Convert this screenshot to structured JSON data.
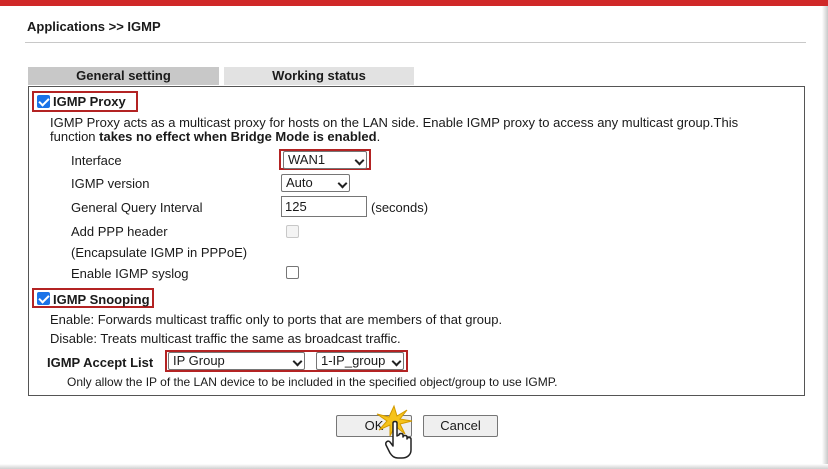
{
  "header": {
    "title": "Applications >> IGMP"
  },
  "tabs": [
    {
      "label": "General setting"
    },
    {
      "label": "Working status"
    }
  ],
  "proxy": {
    "label": "IGMP Proxy",
    "checked": true,
    "desc_line1": "IGMP Proxy acts as a multicast proxy for hosts on the LAN side. Enable IGMP proxy to access any multicast group.This",
    "desc_line2_prefix": "function ",
    "desc_line2_bold": "takes no effect when Bridge Mode is enabled",
    "desc_line2_suffix": ".",
    "interface_label": "Interface",
    "interface_value": "WAN1",
    "version_label": "IGMP version",
    "version_value": "Auto",
    "query_label": "General Query Interval",
    "query_value": "125",
    "query_unit": "(seconds)",
    "ppp_label": "Add PPP header",
    "ppp_sublabel": "(Encapsulate IGMP in PPPoE)",
    "syslog_label": "Enable IGMP syslog"
  },
  "snooping": {
    "label": "IGMP Snooping",
    "checked": true,
    "enable_text": "Enable: Forwards multicast traffic only to ports that are members of that group.",
    "disable_text": "Disable: Treats multicast traffic the same as broadcast traffic."
  },
  "accept_list": {
    "label": "IGMP Accept List",
    "type_value": "IP Group",
    "group_value": "1-IP_group",
    "note": "Only allow the IP of the LAN device to be included in the specified object/group to use IGMP."
  },
  "buttons": {
    "ok": "OK",
    "cancel": "Cancel"
  },
  "colors": {
    "highlight": "#b32323",
    "topbar": "#d02828",
    "tab_active": "#c8c8c8"
  }
}
